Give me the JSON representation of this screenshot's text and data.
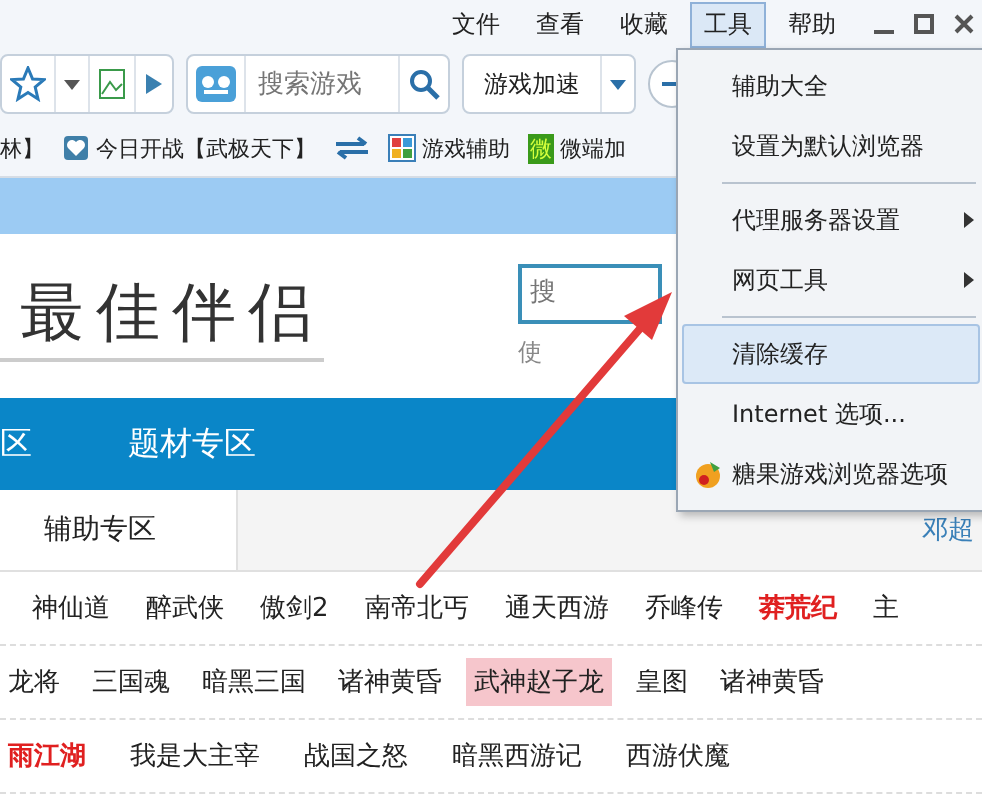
{
  "menubar": {
    "items": [
      {
        "label": "文件",
        "selected": false
      },
      {
        "label": "查看",
        "selected": false
      },
      {
        "label": "收藏",
        "selected": false
      },
      {
        "label": "工具",
        "selected": true
      },
      {
        "label": "帮助",
        "selected": false
      }
    ]
  },
  "toolbar": {
    "search": {
      "placeholder": "搜索游戏"
    },
    "accelerator": {
      "label": "游戏加速"
    }
  },
  "bookmarks": [
    {
      "kind": "text",
      "label": "林】"
    },
    {
      "kind": "heart",
      "label": "今日开战【武极天下】"
    },
    {
      "kind": "swap"
    },
    {
      "kind": "grid",
      "label": "游戏辅助"
    },
    {
      "kind": "badge",
      "badge": "微",
      "label": "微端加"
    }
  ],
  "page": {
    "logo_text": "最佳伴侣",
    "site_search": {
      "placeholder": "搜"
    },
    "hint": "使",
    "nav": [
      "区",
      "题材专区"
    ],
    "tab": "辅助专区",
    "user": "邓超",
    "game_rows": [
      [
        {
          "name": "神仙道",
          "kind": "normal"
        },
        {
          "name": "醉武侠",
          "kind": "normal"
        },
        {
          "name": "傲剑2",
          "kind": "normal"
        },
        {
          "name": "南帝北丐",
          "kind": "normal"
        },
        {
          "name": "通天西游",
          "kind": "normal"
        },
        {
          "name": "乔峰传",
          "kind": "normal"
        },
        {
          "name": "莽荒纪",
          "kind": "hot"
        },
        {
          "name": "主",
          "kind": "normal"
        }
      ],
      [
        {
          "name": "龙将",
          "kind": "normal"
        },
        {
          "name": "三国魂",
          "kind": "normal"
        },
        {
          "name": "暗黑三国",
          "kind": "normal"
        },
        {
          "name": "诸神黄昏",
          "kind": "normal"
        },
        {
          "name": "武神赵子龙",
          "kind": "highlight"
        },
        {
          "name": "皇图",
          "kind": "normal"
        },
        {
          "name": "诸神黄昏",
          "kind": "normal"
        }
      ],
      [
        {
          "name": "雨江湖",
          "kind": "hot"
        },
        {
          "name": "我是大主宰",
          "kind": "normal"
        },
        {
          "name": "战国之怒",
          "kind": "normal"
        },
        {
          "name": "暗黑西游记",
          "kind": "normal"
        },
        {
          "name": "西游伏魔",
          "kind": "normal"
        }
      ]
    ]
  },
  "menu": {
    "items": [
      {
        "kind": "item",
        "label": "辅助大全",
        "submenu": false,
        "selected": false
      },
      {
        "kind": "item",
        "label": "设置为默认浏览器",
        "submenu": false,
        "selected": false
      },
      {
        "kind": "separator"
      },
      {
        "kind": "item",
        "label": "代理服务器设置",
        "submenu": true,
        "selected": false
      },
      {
        "kind": "item",
        "label": "网页工具",
        "submenu": true,
        "selected": false
      },
      {
        "kind": "separator"
      },
      {
        "kind": "item",
        "label": "清除缓存",
        "submenu": false,
        "selected": true
      },
      {
        "kind": "item",
        "label": "Internet 选项...",
        "submenu": false,
        "selected": false
      },
      {
        "kind": "candy",
        "label": "糖果游戏浏览器选项",
        "submenu": false,
        "selected": false
      }
    ]
  }
}
